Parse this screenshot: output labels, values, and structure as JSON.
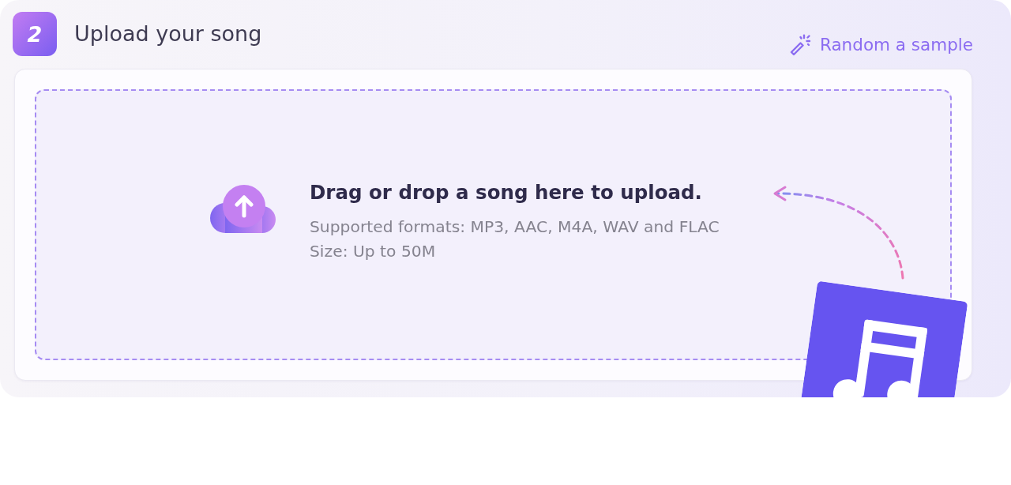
{
  "step": {
    "number": "2",
    "title": "Upload your song"
  },
  "random_sample": {
    "label": "Random a sample"
  },
  "dropzone": {
    "title": "Drag or drop a song here to upload.",
    "formats": "Supported formats: MP3, AAC, M4A, WAV and FLAC",
    "size_limit": "Size: Up to 50M"
  }
}
